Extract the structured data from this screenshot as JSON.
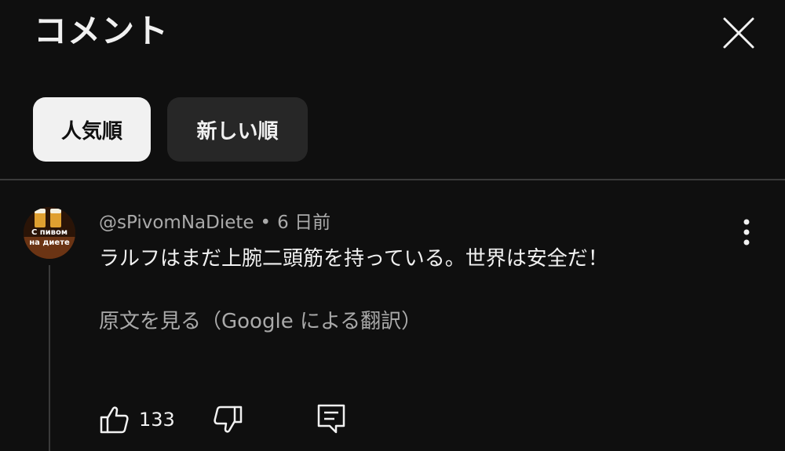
{
  "header": {
    "title": "コメント",
    "close_icon": "close-icon"
  },
  "sort_chips": [
    {
      "label": "人気順",
      "selected": true
    },
    {
      "label": "新しい順",
      "selected": false
    }
  ],
  "comment": {
    "author": "@sPivomNaDiete",
    "separator": "•",
    "time": "6 日前",
    "text": "ラルフはまだ上腕二頭筋を持っている。世界は安全だ！",
    "translate_link": "原文を見る（Google による翻訳）",
    "avatar_text_line1": "С пивом",
    "avatar_text_line2": "на диете",
    "like_count": "133",
    "icons": {
      "more": "more-vert-icon",
      "like": "thumbs-up-icon",
      "dislike": "thumbs-down-icon",
      "reply": "reply-icon"
    }
  },
  "colors": {
    "background": "#0f0f0f",
    "chip_selected_bg": "#f1f1f1",
    "chip_unselected_bg": "#272727",
    "text_primary": "#f1f1f1",
    "text_secondary": "#aaaaaa",
    "divider": "#3a3a3a"
  }
}
